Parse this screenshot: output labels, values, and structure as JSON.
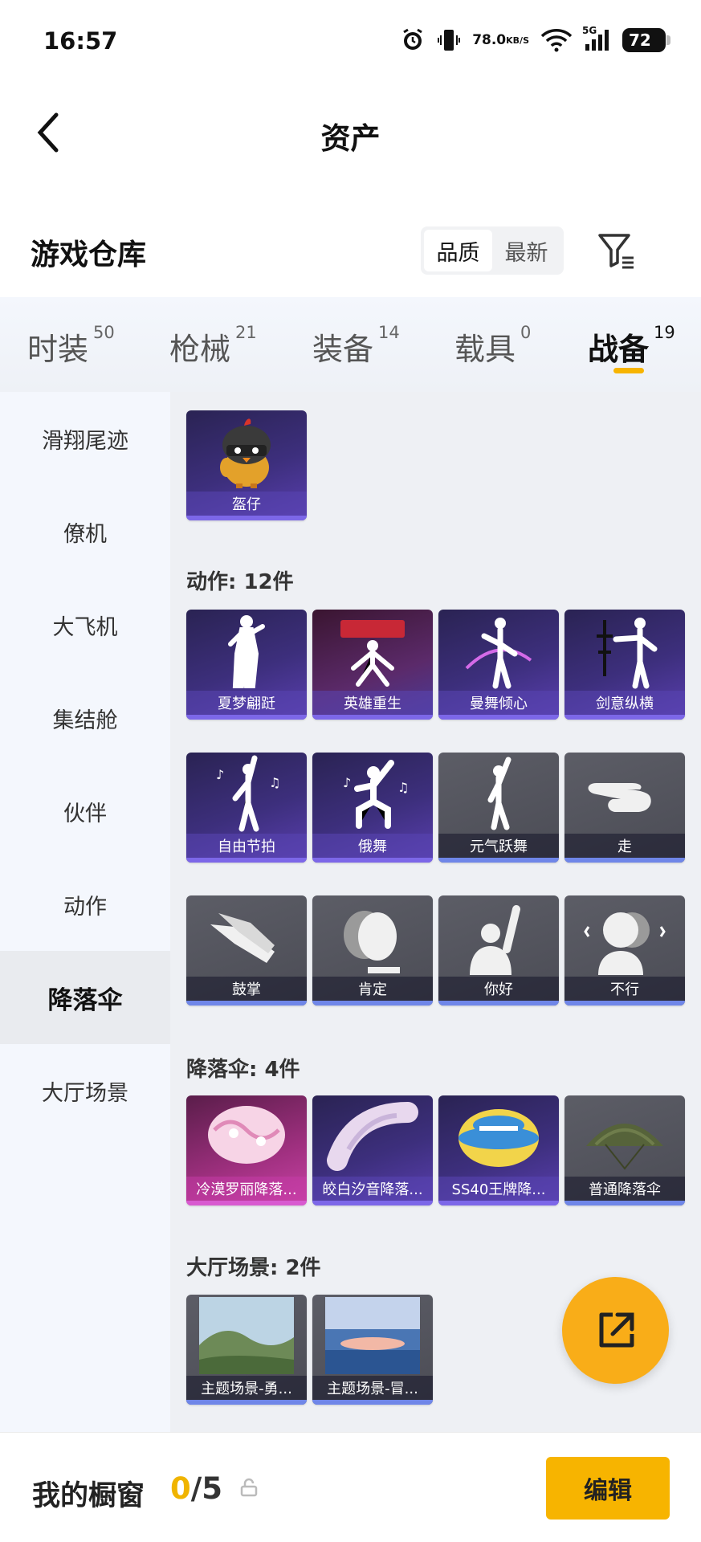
{
  "status": {
    "time": "16:57",
    "speed": "78.0",
    "speed_unit": "KB/S",
    "network": "5G",
    "battery": "72"
  },
  "header": {
    "title": "资产"
  },
  "warehouse": {
    "title": "游戏仓库",
    "sort_options": [
      "品质",
      "最新"
    ],
    "sort_selected": "品质"
  },
  "tabs": [
    {
      "label": "时装",
      "count": "50"
    },
    {
      "label": "枪械",
      "count": "21"
    },
    {
      "label": "装备",
      "count": "14"
    },
    {
      "label": "载具",
      "count": "0"
    },
    {
      "label": "战备",
      "count": "19",
      "active": true
    }
  ],
  "sidebar": {
    "items": [
      {
        "label": "滑翔尾迹"
      },
      {
        "label": "僚机"
      },
      {
        "label": "大飞机"
      },
      {
        "label": "集结舱"
      },
      {
        "label": "伙伴"
      },
      {
        "label": "动作"
      },
      {
        "label": "降落伞",
        "active": true
      },
      {
        "label": "大厅场景"
      }
    ]
  },
  "partner": {
    "items": [
      {
        "label": "盔仔",
        "icon": "helmet-chick-icon"
      }
    ]
  },
  "actions": {
    "heading": "动作: 12件",
    "items": [
      {
        "label": "夏梦翩跹",
        "rarity": "purple"
      },
      {
        "label": "英雄重生",
        "rarity": "purple"
      },
      {
        "label": "曼舞倾心",
        "rarity": "purple"
      },
      {
        "label": "剑意纵横",
        "rarity": "purple"
      },
      {
        "label": "自由节拍",
        "rarity": "purple"
      },
      {
        "label": "俄舞",
        "rarity": "purple"
      },
      {
        "label": "元气跃舞",
        "rarity": "gray"
      },
      {
        "label": "走",
        "rarity": "gray"
      },
      {
        "label": "鼓掌",
        "rarity": "gray"
      },
      {
        "label": "肯定",
        "rarity": "gray"
      },
      {
        "label": "你好",
        "rarity": "gray"
      },
      {
        "label": "不行",
        "rarity": "gray"
      }
    ]
  },
  "parachutes": {
    "heading": "降落伞: 4件",
    "items": [
      {
        "label": "冷漠罗丽降落...",
        "rarity": "pink"
      },
      {
        "label": "皎白汐音降落...",
        "rarity": "purple"
      },
      {
        "label": "SS40王牌降...",
        "rarity": "purple"
      },
      {
        "label": "普通降落伞",
        "rarity": "gray"
      }
    ]
  },
  "lobby": {
    "heading": "大厅场景: 2件",
    "items": [
      {
        "label": "主题场景-勇..."
      },
      {
        "label": "主题场景-冒..."
      }
    ]
  },
  "showcase": {
    "title": "我的橱窗",
    "current": "0",
    "total": "/5",
    "edit_label": "编辑"
  },
  "colors": {
    "accent": "#f7b400",
    "purple_card": "#3d2f7d",
    "gray_card": "#4b4c55",
    "pink_card": "#a03080"
  }
}
